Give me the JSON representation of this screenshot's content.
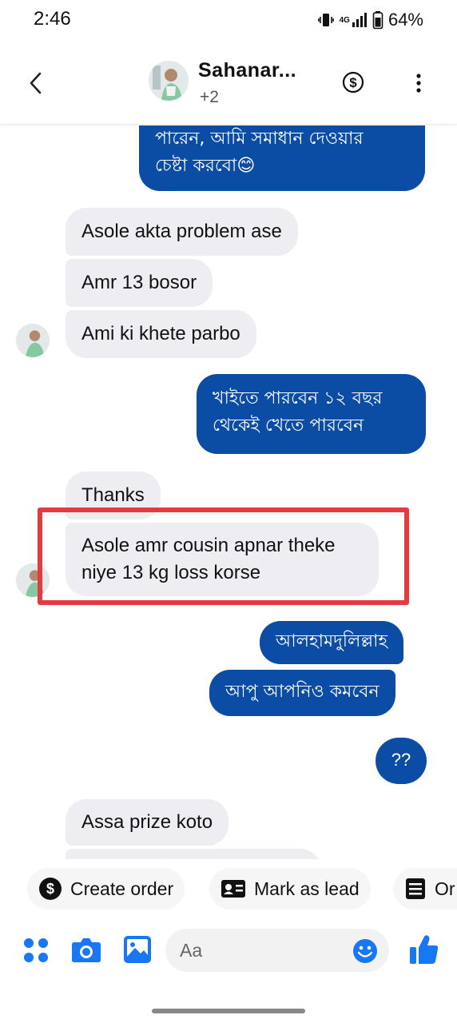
{
  "status_bar": {
    "time": "2:46",
    "network": "4G",
    "battery": "64%"
  },
  "header": {
    "title": "Sahanar...",
    "subtitle": "+2",
    "icons": [
      "back-arrow-icon",
      "dollar-icon",
      "more-vert-icon"
    ]
  },
  "messages": [
    {
      "from": "me",
      "text": "পারেন, আমি সমাধান দেওয়ার"
    },
    {
      "from": "me",
      "text": "চেষ্টা করবো😊"
    },
    {
      "from": "contact",
      "text": "Asole akta problem ase"
    },
    {
      "from": "contact",
      "text": "Amr 13 bosor"
    },
    {
      "from": "contact",
      "text": "Ami ki khete parbo"
    },
    {
      "from": "me",
      "text": "খাইতে পারবেন ১২ বছর"
    },
    {
      "from": "me",
      "text": "থেকেই খেতে পারবেন"
    },
    {
      "from": "contact",
      "text": "Thanks"
    },
    {
      "from": "contact",
      "text": "Asole amr cousin apnar theke"
    },
    {
      "from": "contact",
      "text": "niye 13 kg loss korse"
    },
    {
      "from": "me",
      "text": "আলহামদুলিল্লাহ"
    },
    {
      "from": "me",
      "text": "আপু আপনিও কমবেন"
    },
    {
      "from": "me",
      "text": "??"
    },
    {
      "from": "contact",
      "text": "Assa prize koto"
    }
  ],
  "quick_actions": [
    {
      "label": "Create order",
      "icon": "dollar-circle-icon"
    },
    {
      "label": "Mark as lead",
      "icon": "id-card-icon"
    },
    {
      "label": "Or",
      "icon": "form-icon"
    }
  ],
  "composer": {
    "placeholder": "Aa",
    "icons": [
      "apps-icon",
      "camera-icon",
      "gallery-icon",
      "emoji-icon",
      "like-icon"
    ]
  },
  "colors": {
    "outgoing_bubble": "#0b4ca5",
    "incoming_bubble": "#eeedf1",
    "accent": "#1877f2",
    "highlight_box": "#e53a40"
  }
}
